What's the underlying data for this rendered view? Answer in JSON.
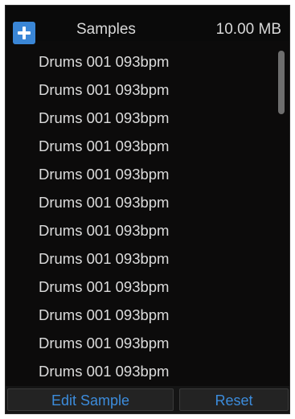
{
  "header": {
    "add_icon": "plus-icon",
    "title": "Samples",
    "size": "10.00 MB"
  },
  "samples": {
    "items": [
      "Drums 001 093bpm",
      "Drums 001 093bpm",
      "Drums 001 093bpm",
      "Drums 001 093bpm",
      "Drums 001 093bpm",
      "Drums 001 093bpm",
      "Drums 001 093bpm",
      "Drums 001 093bpm",
      "Drums 001 093bpm",
      "Drums 001 093bpm",
      "Drums 001 093bpm",
      "Drums 001 093bpm"
    ]
  },
  "footer": {
    "edit_label": "Edit Sample",
    "reset_label": "Reset"
  },
  "colors": {
    "accent": "#3a86d6",
    "background": "#0c0b0b",
    "text": "#dcdcdc",
    "button_text": "#3c8cdc"
  }
}
